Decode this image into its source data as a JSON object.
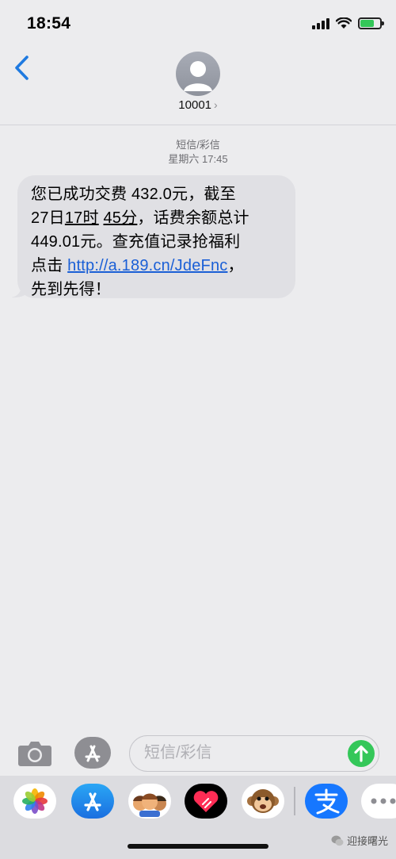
{
  "status_bar": {
    "time": "18:54"
  },
  "header": {
    "contact": "10001",
    "chevron": "›"
  },
  "thread": {
    "service": "短信/彩信",
    "timestamp": "星期六 17:45",
    "message": {
      "line1": "您已成功交费 432.0元，截至",
      "line2_pre": "27日",
      "line2_hour": "17时",
      "line2_sp": " ",
      "line2_min": "45分",
      "line2_post": "，话费余额总计",
      "line3": "449.01元。查充值记录抢福利",
      "line4_pre": "点击 ",
      "link": "http://a.189.cn/JdeFnc",
      "line4_post": "，",
      "line5": "先到先得！"
    }
  },
  "input_bar": {
    "placeholder": "短信/彩信"
  },
  "app_tray": {
    "apps": [
      "photos",
      "app-store",
      "memoji",
      "digital-touch",
      "animoji",
      "alipay",
      "more"
    ]
  },
  "watermark": {
    "text": "迎接曙光"
  },
  "colors": {
    "link": "#1a5fd6",
    "send": "#34c759",
    "back": "#1f7ae0"
  }
}
